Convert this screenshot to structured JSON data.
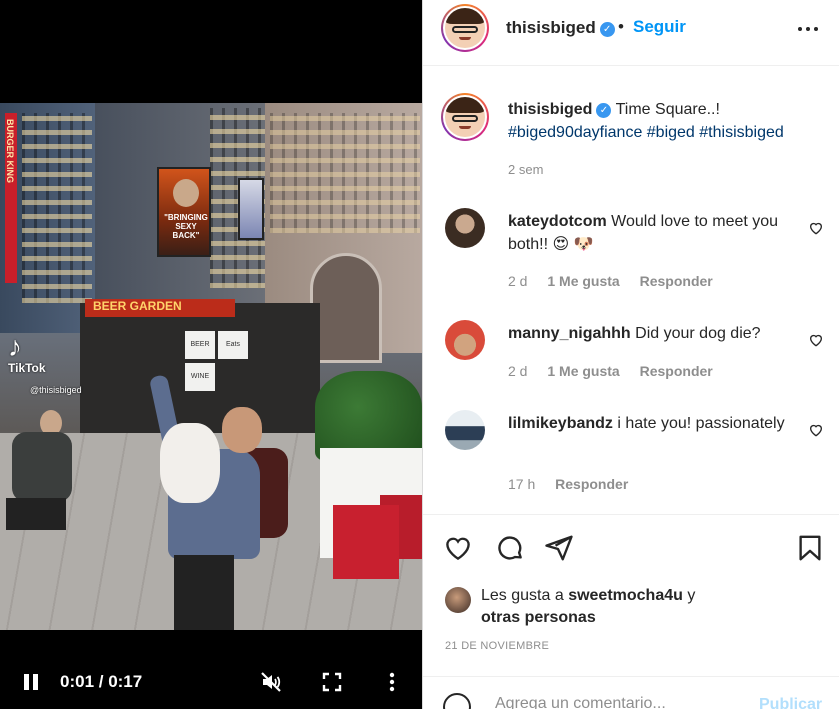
{
  "video": {
    "billboard_text": "\"BRINGING SEXY BACK\"",
    "kiosk_sign": "BEER GARDEN",
    "kiosk_panels": [
      "BEER",
      "WINE",
      "Eats"
    ],
    "vertical_sign": "BURGER KING",
    "watermark_brand": "TikTok",
    "watermark_user": "@thisisbiged",
    "time_display": "0:01 / 0:17"
  },
  "header": {
    "username": "thisisbiged",
    "verified": true,
    "dot": "•",
    "follow_label": "Seguir"
  },
  "caption": {
    "username": "thisisbiged",
    "text": "Time Square..!",
    "hashtags": "#biged90dayfiance #biged #thisisbiged",
    "time": "2 sem"
  },
  "comments": [
    {
      "username": "kateydotcom",
      "text": "Would love to meet you both!! 😍 🐶",
      "time": "2 d",
      "likes": "1 Me gusta",
      "reply": "Responder",
      "avatar_color": "#5a4a3c"
    },
    {
      "username": "manny_nigahhh",
      "text": "Did your dog die?",
      "time": "2 d",
      "likes": "1 Me gusta",
      "reply": "Responder",
      "avatar_color": "#d94b3a"
    },
    {
      "username": "lilmikeybandz",
      "text": "i hate you! passionately",
      "time": "17 h",
      "likes": "",
      "reply": "Responder",
      "avatar_color": "#8fa6b8"
    }
  ],
  "likes": {
    "prefix": "Les gusta a",
    "user": "sweetmocha4u",
    "conj": "y",
    "others": "otras personas"
  },
  "date": "21 DE NOVIEMBRE",
  "comment_box": {
    "placeholder": "Agrega un comentario...",
    "publish_label": "Publicar"
  },
  "colors": {
    "accent": "#0095f6",
    "hashtag": "#00376b",
    "muted": "#8e8e8e",
    "verified": "#3897f0"
  }
}
